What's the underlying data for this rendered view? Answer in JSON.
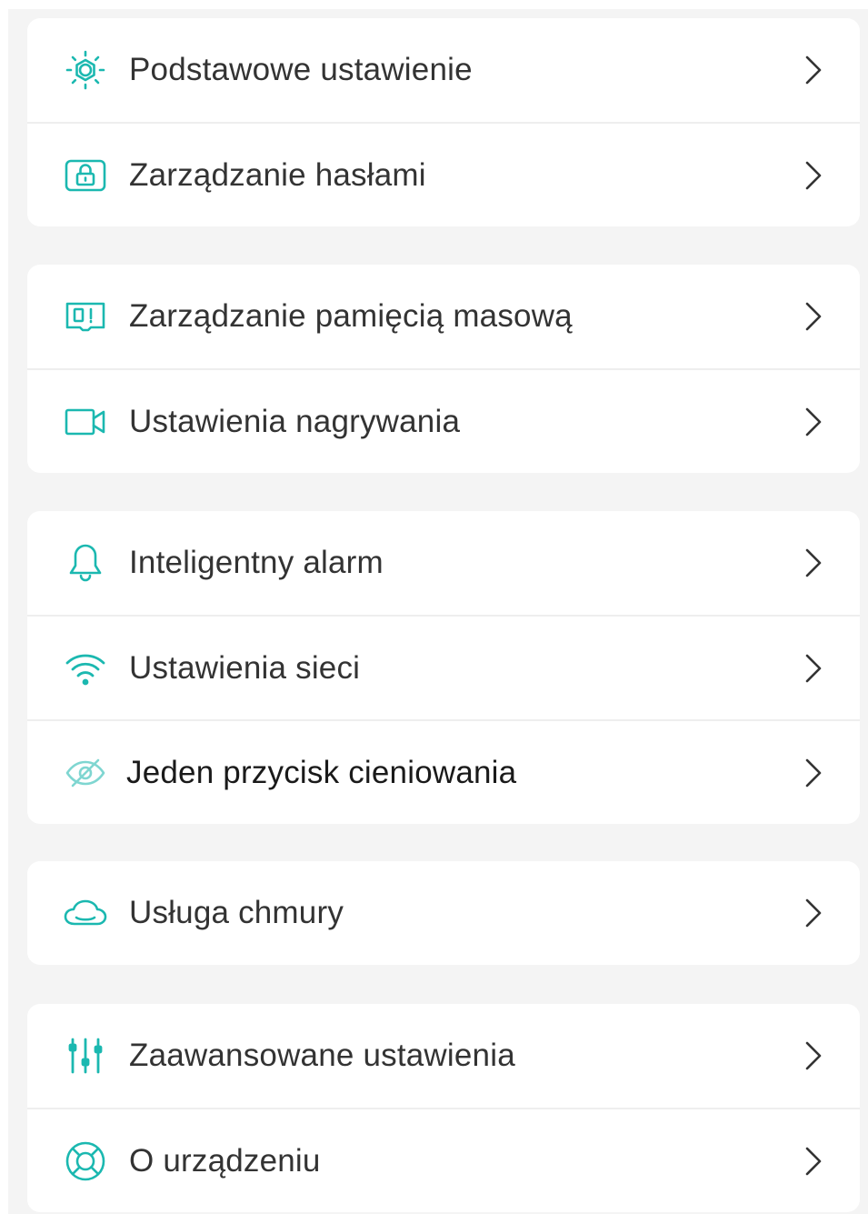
{
  "accent_color": "#1bb8b0",
  "groups": [
    {
      "items": [
        {
          "label": "Podstawowe ustawienie",
          "icon": "gear-icon"
        },
        {
          "label": "Zarządzanie hasłami",
          "icon": "lock-icon"
        }
      ]
    },
    {
      "items": [
        {
          "label": "Zarządzanie pamięcią masową",
          "icon": "storage-card-icon"
        },
        {
          "label": "Ustawienia nagrywania",
          "icon": "video-camera-icon"
        }
      ]
    },
    {
      "items": [
        {
          "label": "Inteligentny alarm",
          "icon": "bell-icon"
        },
        {
          "label": "Ustawienia sieci",
          "icon": "wifi-icon"
        },
        {
          "label": "Jeden przycisk cieniowania",
          "icon": "eye-off-icon"
        }
      ]
    },
    {
      "items": [
        {
          "label": "Usługa chmury",
          "icon": "cloud-icon"
        }
      ]
    },
    {
      "items": [
        {
          "label": "Zaawansowane ustawienia",
          "icon": "sliders-icon"
        },
        {
          "label": "O urządzeniu",
          "icon": "lifebuoy-icon"
        }
      ]
    }
  ]
}
